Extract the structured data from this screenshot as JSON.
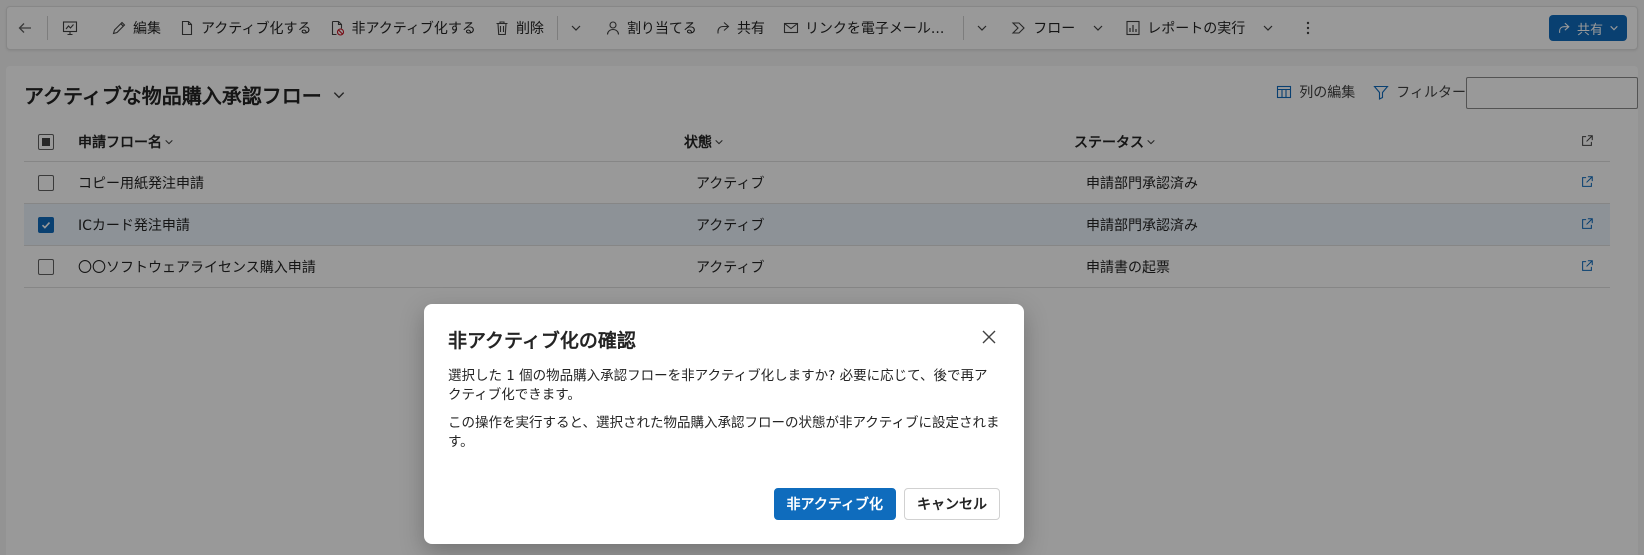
{
  "toolbar": {
    "edit": "編集",
    "activate": "アクティブ化する",
    "deactivate": "非アクティブ化する",
    "delete": "削除",
    "assign": "割り当てる",
    "share": "共有",
    "email_link": "リンクを電子メール...",
    "flow": "フロー",
    "run_report": "レポートの実行",
    "share_button": "共有"
  },
  "view": {
    "title": "アクティブな物品購入承認フロー",
    "edit_columns": "列の編集",
    "edit_filters": "フィルターを編集する",
    "search_value": "",
    "search_placeholder": ""
  },
  "grid": {
    "columns": {
      "name": "申請フロー名",
      "state": "状態",
      "status": "ステータス"
    },
    "rows": [
      {
        "name": "コピー用紙発注申請",
        "state": "アクティブ",
        "status": "申請部門承認済み",
        "selected": false
      },
      {
        "name": "ICカード発注申請",
        "state": "アクティブ",
        "status": "申請部門承認済み",
        "selected": true
      },
      {
        "name": "〇〇ソフトウェアライセンス購入申請",
        "state": "アクティブ",
        "status": "申請書の起票",
        "selected": false
      }
    ]
  },
  "dialog": {
    "title": "非アクティブ化の確認",
    "message1": "選択した 1 個の物品購入承認フローを非アクティブ化しますか? 必要に応じて、後で再アクティブ化できます。",
    "message2": "この操作を実行すると、選択された物品購入承認フローの状態が非アクティブに設定されます。",
    "confirm_label": "非アクティブ化",
    "cancel_label": "キャンセル"
  },
  "colors": {
    "accent": "#0f6cbd",
    "selected_row": "#ebf3fc",
    "overlay": "#000000"
  }
}
